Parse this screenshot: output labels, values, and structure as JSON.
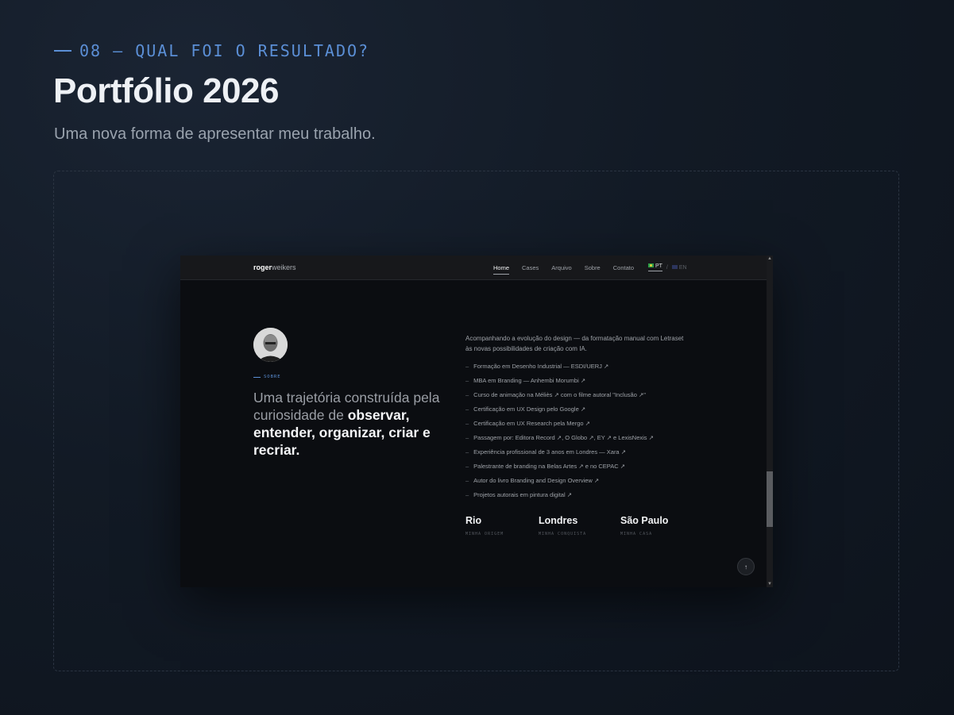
{
  "section": {
    "eyebrow": "08 — QUAL FOI O RESULTADO?",
    "title": "Portfólio 2026",
    "subtitle": "Uma nova forma de apresentar meu trabalho."
  },
  "site": {
    "logo_bold": "roger",
    "logo_light": "weikers",
    "nav": [
      "Home",
      "Cases",
      "Arquivo",
      "Sobre",
      "Contato"
    ],
    "nav_active": "Home",
    "lang_pt": "PT",
    "lang_sep": "/",
    "lang_en": "EN",
    "about_tag": "SOBRE",
    "heading_light": "Uma trajetória construída pela curiosidade de",
    "heading_bold": "observar, entender, organizar, criar e recriar.",
    "intro": "Acompanhando a evolução do design — da formatação manual com Letraset às novas possibilidades de criação com IA.",
    "items": [
      "Formação em Desenho Industrial — ESDI/UERJ ↗",
      "MBA em Branding — Anhembi Morumbi ↗",
      "Curso de animação na Méliès ↗ com o filme autoral \"Inclusão ↗\"",
      "Certificação em UX Design pelo Google ↗",
      "Certificação em UX Research pela Mergo ↗",
      "Passagem por: Editora Record ↗, O Globo ↗, EY ↗ e LexisNexis ↗",
      "Experiência profissional de 3 anos em Londres — Xara ↗",
      "Palestrante de branding na Belas Artes ↗ e no CEPAC ↗",
      "Autor do livro Branding and Design Overview ↗",
      "Projetos autorais em pintura digital ↗"
    ],
    "cities": [
      {
        "name": "Rio",
        "sub": "MINHA ORIGEM"
      },
      {
        "name": "Londres",
        "sub": "MINHA CONQUISTA"
      },
      {
        "name": "São Paulo",
        "sub": "MINHA CASA"
      }
    ],
    "back_to_top": "↑"
  },
  "colors": {
    "accent": "#5b8fd6",
    "page_bg": "#121a25",
    "site_bg": "#0b0d11"
  }
}
